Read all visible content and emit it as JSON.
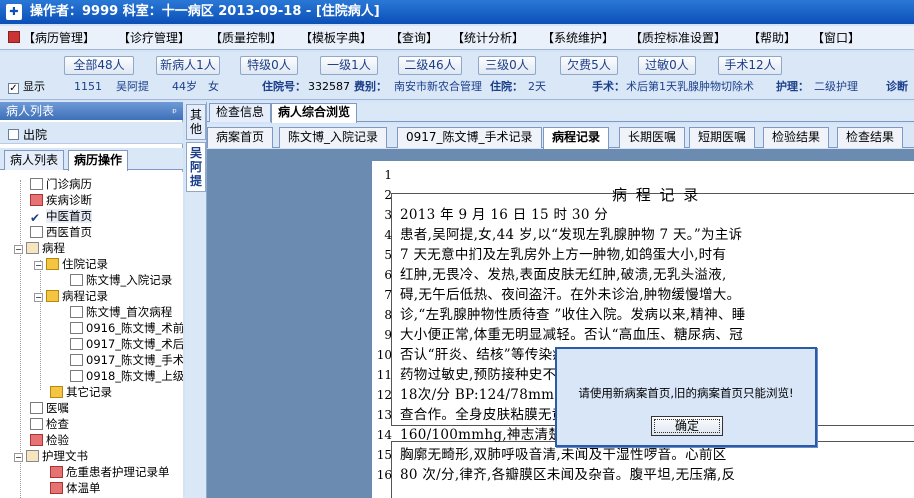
{
  "titlebar": {
    "title": "操作者：9999   科室：十一病区   2013-09-18 - [住院病人]"
  },
  "menu": [
    {
      "label": "【病历管理】"
    },
    {
      "label": "【诊疗管理】"
    },
    {
      "label": "【质量控制】"
    },
    {
      "label": "【模板字典】"
    },
    {
      "label": "【查询】"
    },
    {
      "label": "【统计分析】"
    },
    {
      "label": "【系统维护】"
    },
    {
      "label": "【质控标准设置】"
    },
    {
      "label": "【帮助】"
    },
    {
      "label": "【窗口】"
    }
  ],
  "filters": [
    {
      "label": "全部48人"
    },
    {
      "label": "新病人1人"
    },
    {
      "label": "特级0人"
    },
    {
      "label": "一级1人"
    },
    {
      "label": "二级46人"
    },
    {
      "label": "三级0人"
    },
    {
      "label": "欠费5人"
    },
    {
      "label": "过敏0人"
    },
    {
      "label": "手术12人"
    }
  ],
  "patient_info": {
    "show_label": "显示",
    "bed": "1151",
    "name": "吴阿提",
    "age": "44岁",
    "sex": "女",
    "admission_label": "住院号：",
    "admission_no": "332587",
    "fee_label": "费别：",
    "fee_value": "南安市新农合管理",
    "days_label": "住院：",
    "days_value": "2天",
    "surgery_label": "手术：",
    "surgery_value": "术后第1天乳腺肿物切除术",
    "nursing_label": "护理：",
    "nursing_value": "二级护理",
    "diag_label": "诊断"
  },
  "left_panel": {
    "header": "病人列表",
    "pin": "ᵖ",
    "checkbox_label": "出院",
    "tabs": [
      {
        "label": "病人列表"
      },
      {
        "label": "病历操作"
      }
    ]
  },
  "tree": [
    {
      "label": "门诊病历"
    },
    {
      "label": "疾病诊断"
    },
    {
      "label": "中医首页"
    },
    {
      "label": "西医首页"
    },
    {
      "label": "病程"
    },
    {
      "label": "住院记录"
    },
    {
      "label": "陈文博_入院记录"
    },
    {
      "label": "病程记录"
    },
    {
      "label": "陈文博_首次病程"
    },
    {
      "label": "0916_陈文博_术前"
    },
    {
      "label": "0917_陈文博_术后"
    },
    {
      "label": "0917_陈文博_手术"
    },
    {
      "label": "0918_陈文博_上级"
    },
    {
      "label": "其它记录"
    },
    {
      "label": "医嘱"
    },
    {
      "label": "检查"
    },
    {
      "label": "检验"
    },
    {
      "label": "护理文书"
    },
    {
      "label": "危重患者护理记录单"
    },
    {
      "label": "体温单"
    }
  ],
  "vertical_tabs": [
    {
      "label": "其他"
    },
    {
      "label": "吴阿提"
    }
  ],
  "top_tabs": [
    {
      "label": "检查信息"
    },
    {
      "label": "病人综合浏览"
    }
  ],
  "doc_tabs": [
    {
      "label": "病案首页"
    },
    {
      "label": "陈文博_入院记录"
    },
    {
      "label": "0917_陈文博_手术记录"
    },
    {
      "label": "病程记录"
    },
    {
      "label": "长期医嘱"
    },
    {
      "label": "短期医嘱"
    },
    {
      "label": "检验结果"
    },
    {
      "label": "检查结果"
    }
  ],
  "document": {
    "line_numbers": [
      "1",
      "2",
      "3",
      "4",
      "5",
      "6",
      "7",
      "8",
      "9",
      "10",
      "11",
      "12",
      "13",
      "14",
      "15",
      "16"
    ],
    "lines": [
      "",
      "病  程  记  录",
      "2013 年 9 月 16 日 15 时 30 分",
      "    患者,吴阿提,女,44 岁,以“发现左乳腺肿物 7 天。”为主诉",
      "7 天无意中扪及左乳房外上方一肿物,如鸽蛋大小,时有",
      "红肿,无畏冷、发热,表面皮肤无红肿,破溃,无乳头溢液,",
      "碍,无午后低热、夜间盗汗。在外未诊治,肿物缓慢增大。",
      "诊,“左乳腺肿物性质待查 ”收住入院。发病以来,精神、睡",
      "大小便正常,体重无明显减轻。否认“高血压、糖尿病、冠",
      "否认“肝炎、结核”等传染病病史,无手术史,无输血史,",
      "药物过敏史,预防接种史不详。入院查体格检查：T:3",
      "18次/分 BP:124/78mmHg,神志清楚,发育正常 ,营养中",
      "查合作。全身皮肤粘膜无黄染,T:36.8℃P:80 次/分",
      "160/100mmhg,神志清楚,查体配合。皮肤粘膜无黄染,全身",
      "胸廓无畸形,双肺呼吸音清,未闻及干湿性啰音。心前区",
      "80 次/分,律齐,各瓣膜区未闻及杂音。腹平坦,无压痛,反"
    ]
  },
  "dialog": {
    "message": "请使用新病案首页,旧的病案首页只能浏览!",
    "ok_label": "确定"
  }
}
